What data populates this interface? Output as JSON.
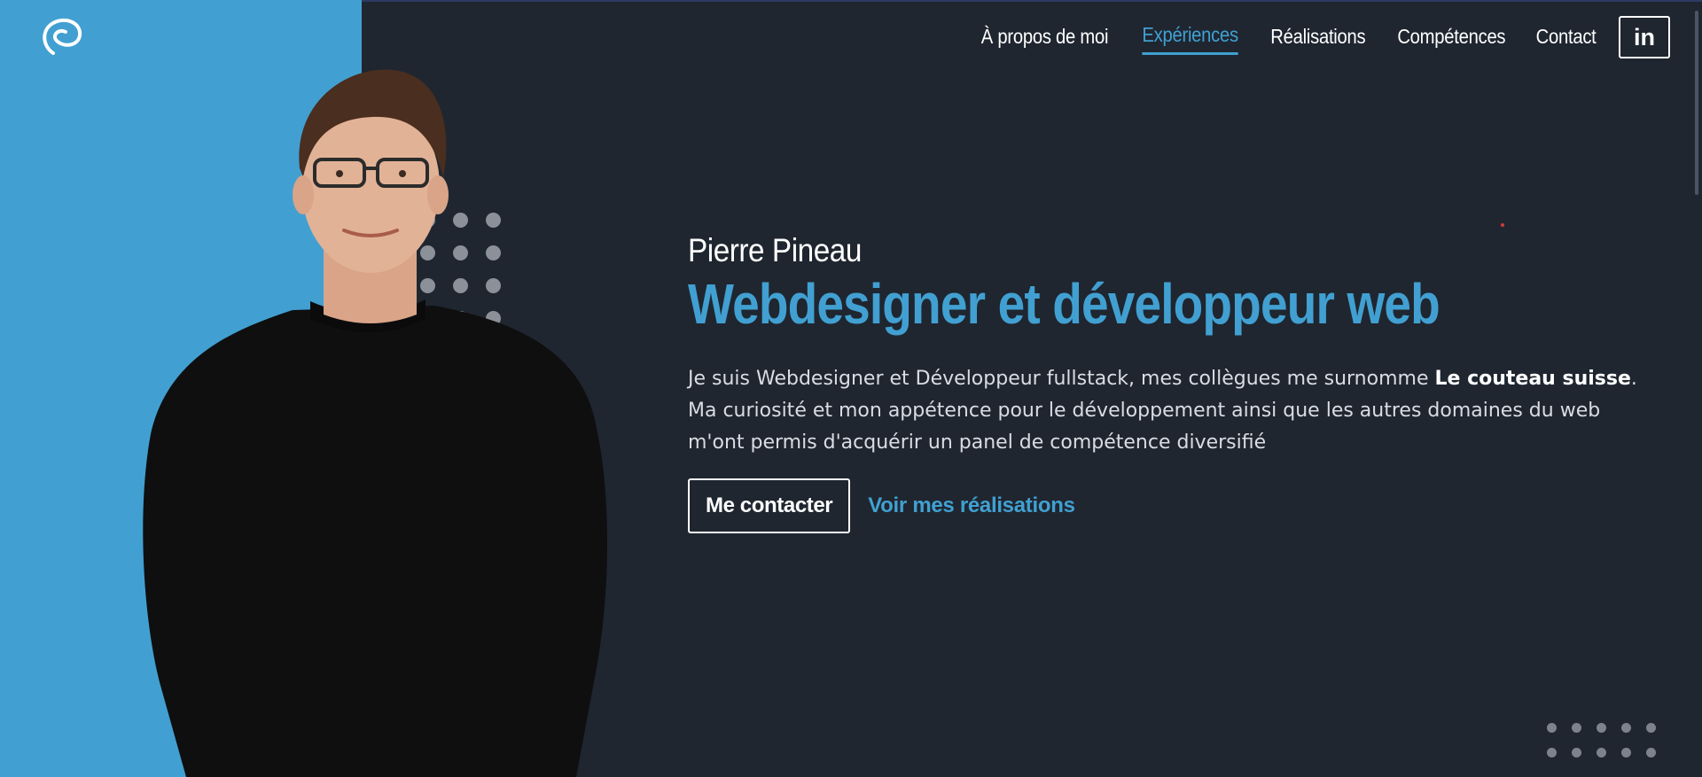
{
  "nav": {
    "items": [
      {
        "label": "À propos de moi",
        "active": false
      },
      {
        "label": "Expériences",
        "active": true
      },
      {
        "label": "Réalisations",
        "active": false
      },
      {
        "label": "Compétences",
        "active": false
      },
      {
        "label": "Contact",
        "active": false
      }
    ],
    "linkedin_label": "in"
  },
  "hero": {
    "name": "Pierre Pineau",
    "title": "Webdesigner et développeur web",
    "text_before": "Je suis Webdesigner et Développeur fullstack, mes collègues me surnomme ",
    "text_strong": "Le couteau suisse",
    "text_after": ". Ma curiosité et mon appétence pour le développement ainsi que les autres domaines du web m'ont permis d'acquérir un panel de compétence diversifié",
    "primary_button": "Me contacter",
    "secondary_link": "Voir mes réalisations"
  },
  "colors": {
    "accent": "#41a0d1",
    "background": "#1f2630"
  },
  "icons": {
    "logo": "logo-icon",
    "linkedin": "linkedin-icon"
  }
}
